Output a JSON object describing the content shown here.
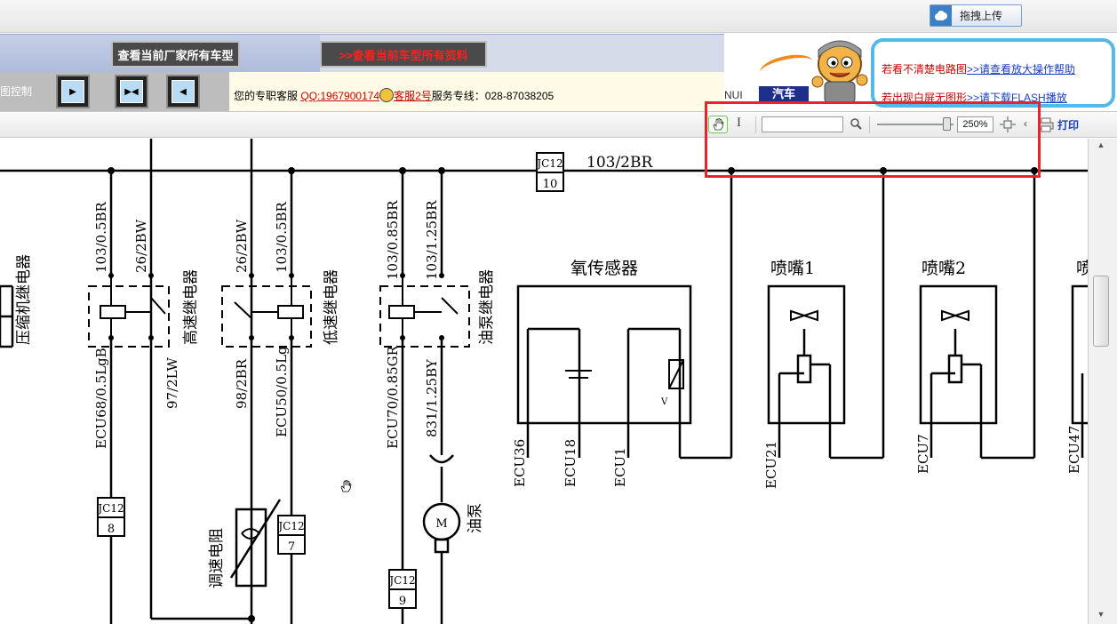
{
  "top": {
    "upload_label": "拖拽上传"
  },
  "nav": {
    "all_models_label": "查看当前厂家所有车型",
    "all_docs_label": ">>查看当前车型所有资料",
    "control_label": "图控制"
  },
  "service": {
    "prefix": "您的专职客服",
    "qq": "QQ:1967900174",
    "agent": "客服2号",
    "hotline": "服务专线：028-87038205"
  },
  "help": {
    "line1_text": "若看不清楚电路图",
    "line1_link": ">>请查看放大操作帮助",
    "line2_text": "若出现白屏无图形",
    "line2_link": ">>请下载FLASH播放",
    "car_label": "汽车",
    "car_mark": "NUI"
  },
  "toolbar": {
    "zoom": "250%",
    "print": "打印",
    "search_value": ""
  },
  "diagram": {
    "top_wire": "103/2BR",
    "connector_label": "JC12",
    "pins": [
      "10",
      "8",
      "7",
      "9"
    ],
    "wires": [
      "103/0.5BR",
      "26/2BW",
      "26/2BW",
      "103/0.5BR",
      "103/0.85BR",
      "103/1.25BR",
      "ECU68/0.5LgB",
      "97/2LW",
      "98/2BR",
      "ECU50/0.5Lg",
      "ECU70/0.85GR",
      "831/1.25BY"
    ],
    "relays": [
      "压缩机继电器",
      "高速继电器",
      "低速继电器",
      "油泵继电器"
    ],
    "components": [
      "氧传感器",
      "喷嘴1",
      "喷嘴2",
      "喷",
      "调速电阻",
      "油泵"
    ],
    "motor_symbol": "M",
    "voltage_symbol": "V",
    "ecu_pins": [
      "ECU36",
      "ECU18",
      "ECU1",
      "ECU21",
      "ECU7",
      "ECU47"
    ]
  }
}
